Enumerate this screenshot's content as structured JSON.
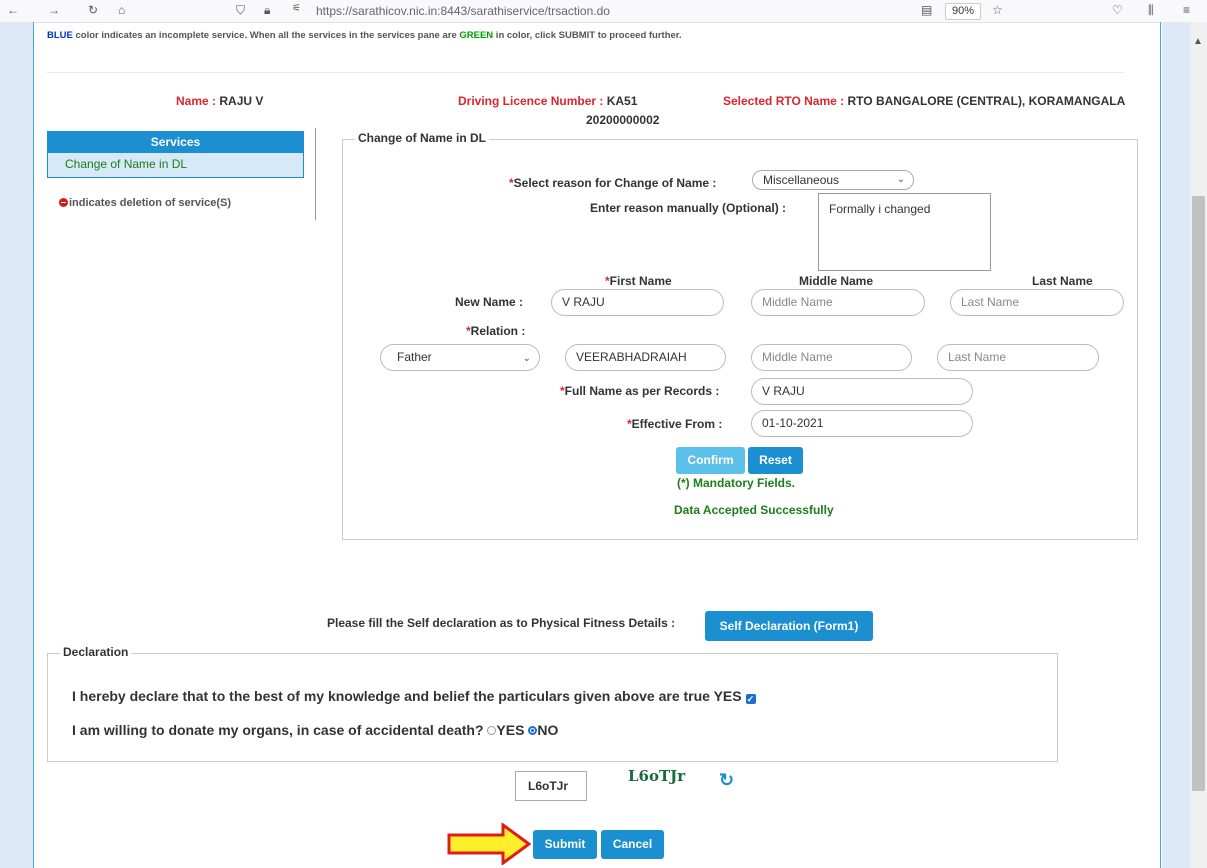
{
  "browser": {
    "back": "←",
    "forward": "→",
    "reload": "↻",
    "home": "⌂",
    "url": "https://sarathicov.nic.in:8443/sarathiservice/trsaction.do",
    "zoom": "90%"
  },
  "instruction": {
    "blue_word": "BLUE",
    "part1": " color indicates an incomplete service. When all the services in the services pane are ",
    "green_word": "GREEN",
    "part2": " in color, click SUBMIT to proceed further."
  },
  "header": {
    "name_label": "Name :",
    "name_value": "RAJU V",
    "dl_label": "Driving Licence Number :",
    "dl_value1": "KA51",
    "dl_value2": "20200000002",
    "rto_label": "Selected RTO Name :",
    "rto_value": "RTO BANGALORE (CENTRAL), KORAMANGALA"
  },
  "services": {
    "title": "Services",
    "items": [
      "Change of Name in DL"
    ],
    "deletion_note": "indicates deletion of service(S)"
  },
  "form": {
    "legend": "Change of Name in DL",
    "reason_label": "Select reason for Change of Name :",
    "reason_value": "Miscellaneous",
    "manual_label": "Enter reason manually (Optional) :",
    "manual_value": "Formally i changed",
    "first_name_header": "First Name",
    "middle_name_header": "Middle Name",
    "last_name_header": "Last Name",
    "new_name_label": "New Name :",
    "new_first": "V RAJU",
    "middle_placeholder": "Middle Name",
    "last_placeholder": "Last Name",
    "relation_label": "Relation :",
    "relation_value": "Father",
    "relation_first": "VEERABHADRAIAH",
    "fullname_label": "Full Name as per Records :",
    "fullname_value": "V RAJU",
    "effective_label": "Effective From :",
    "effective_value": "01-10-2021",
    "confirm_label": "Confirm",
    "reset_label": "Reset",
    "mandatory_note": "(*) Mandatory Fields.",
    "accepted_msg": "Data Accepted Successfully"
  },
  "self_declaration": {
    "label": "Please fill the Self declaration as to Physical Fitness Details :",
    "button": "Self Declaration (Form1)"
  },
  "declaration": {
    "legend": "Declaration",
    "line1": "I hereby declare that to the best of my knowledge and belief the particulars given above are true YES",
    "line2": "I am willing to donate my organs, in case of accidental death?",
    "yes": "YES",
    "no": "NO",
    "organ_choice": "NO"
  },
  "captcha": {
    "input_value": "L6oTJr",
    "image_text": "L6oTJr"
  },
  "actions": {
    "submit": "Submit",
    "cancel": "Cancel"
  }
}
